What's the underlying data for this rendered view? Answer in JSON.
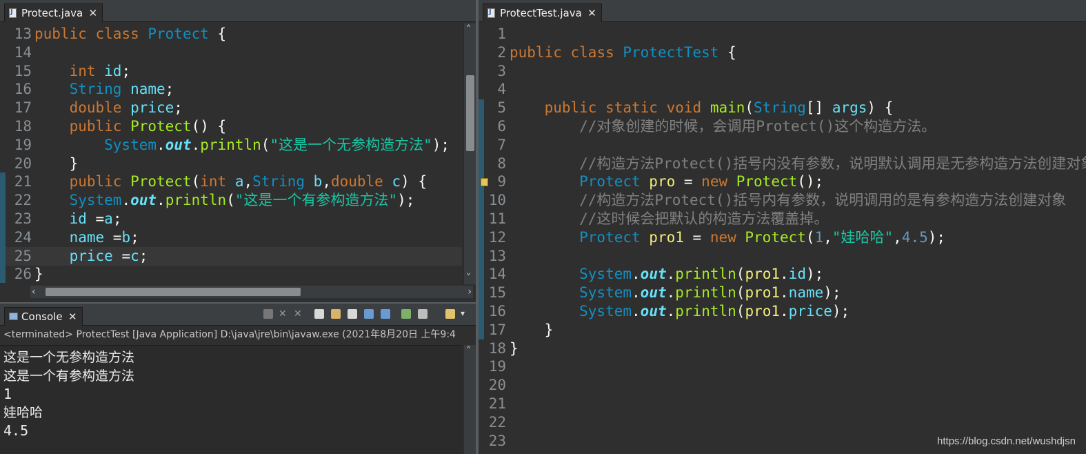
{
  "left_editor": {
    "tab_title": "Protect.java",
    "lines": [
      {
        "n": "13",
        "parts": [
          [
            "kw",
            "public "
          ],
          [
            "kw",
            "class "
          ],
          [
            "cls",
            "Protect "
          ],
          [
            "br",
            "{"
          ]
        ]
      },
      {
        "n": "14",
        "parts": []
      },
      {
        "n": "15",
        "parts": [
          [
            "kw",
            "    int "
          ],
          [
            "fld",
            "id"
          ],
          [
            "br",
            ";"
          ]
        ]
      },
      {
        "n": "16",
        "parts": [
          [
            "cls",
            "    String "
          ],
          [
            "fld",
            "name"
          ],
          [
            "br",
            ";"
          ]
        ]
      },
      {
        "n": "17",
        "parts": [
          [
            "kw",
            "    double "
          ],
          [
            "fld",
            "price"
          ],
          [
            "br",
            ";"
          ]
        ]
      },
      {
        "n": "18",
        "parts": [
          [
            "kw",
            "    public "
          ],
          [
            "mth",
            "Protect"
          ],
          [
            "br",
            "() {"
          ]
        ]
      },
      {
        "n": "19",
        "parts": [
          [
            "cls",
            "        System"
          ],
          [
            "br",
            "."
          ],
          [
            "it",
            "out"
          ],
          [
            "br",
            "."
          ],
          [
            "mth",
            "println"
          ],
          [
            "br",
            "("
          ],
          [
            "str",
            "\"这是一个无参构造方法\""
          ],
          [
            "br",
            ");"
          ]
        ]
      },
      {
        "n": "20",
        "parts": [
          [
            "br",
            "    }"
          ]
        ]
      },
      {
        "n": "21",
        "parts": [
          [
            "kw",
            "    public "
          ],
          [
            "mth",
            "Protect"
          ],
          [
            "br",
            "("
          ],
          [
            "kw",
            "int "
          ],
          [
            "fld",
            "a"
          ],
          [
            "br",
            ","
          ],
          [
            "cls",
            "String "
          ],
          [
            "fld",
            "b"
          ],
          [
            "br",
            ","
          ],
          [
            "kw",
            "double "
          ],
          [
            "fld",
            "c"
          ],
          [
            "br",
            ") {"
          ]
        ]
      },
      {
        "n": "22",
        "parts": [
          [
            "cls",
            "    System"
          ],
          [
            "br",
            "."
          ],
          [
            "it",
            "out"
          ],
          [
            "br",
            "."
          ],
          [
            "mth",
            "println"
          ],
          [
            "br",
            "("
          ],
          [
            "str",
            "\"这是一个有参构造方法\""
          ],
          [
            "br",
            ");"
          ]
        ]
      },
      {
        "n": "23",
        "parts": [
          [
            "fld",
            "    id "
          ],
          [
            "br",
            "="
          ],
          [
            "fld",
            "a"
          ],
          [
            "br",
            ";"
          ]
        ]
      },
      {
        "n": "24",
        "parts": [
          [
            "fld",
            "    name "
          ],
          [
            "br",
            "="
          ],
          [
            "fld",
            "b"
          ],
          [
            "br",
            ";"
          ]
        ]
      },
      {
        "n": "25",
        "parts": [
          [
            "fld",
            "    price "
          ],
          [
            "br",
            "="
          ],
          [
            "fld",
            "c"
          ],
          [
            "br",
            ";"
          ]
        ]
      },
      {
        "n": "26",
        "parts": [
          [
            "br",
            "}"
          ]
        ]
      }
    ]
  },
  "console": {
    "tab_title": "Console",
    "status": "<terminated> ProtectTest [Java Application] D:\\java\\jre\\bin\\javaw.exe (2021年8月20日 上午9:4",
    "output": [
      "这是一个无参构造方法",
      "这是一个有参构造方法",
      "1",
      "娃哈哈",
      "4.5"
    ]
  },
  "right_editor": {
    "tab_title": "ProtectTest.java",
    "lines": [
      {
        "n": "1",
        "parts": []
      },
      {
        "n": "2",
        "parts": [
          [
            "kw",
            "public "
          ],
          [
            "kw",
            "class "
          ],
          [
            "cls",
            "ProtectTest "
          ],
          [
            "br",
            "{"
          ]
        ]
      },
      {
        "n": "3",
        "parts": []
      },
      {
        "n": "4",
        "parts": []
      },
      {
        "n": "5",
        "parts": [
          [
            "kw",
            "    public "
          ],
          [
            "kw",
            "static "
          ],
          [
            "kw",
            "void "
          ],
          [
            "mth",
            "main"
          ],
          [
            "br",
            "("
          ],
          [
            "cls",
            "String"
          ],
          [
            "br",
            "[] "
          ],
          [
            "fld",
            "args"
          ],
          [
            "br",
            ") {"
          ]
        ]
      },
      {
        "n": "6",
        "parts": [
          [
            "cmt",
            "        //对象创建的时候，会调用Protect()这个构造方法。"
          ]
        ]
      },
      {
        "n": "7",
        "parts": []
      },
      {
        "n": "8",
        "parts": [
          [
            "cmt",
            "        //构造方法Protect()括号内没有参数，说明默认调用是无参构造方法创建对象"
          ]
        ]
      },
      {
        "n": "9",
        "parts": [
          [
            "cls",
            "        Protect "
          ],
          [
            "var",
            "pro"
          ],
          [
            "br",
            " = "
          ],
          [
            "kw",
            "new "
          ],
          [
            "mth",
            "Protect"
          ],
          [
            "br",
            "();"
          ]
        ]
      },
      {
        "n": "10",
        "parts": [
          [
            "cmt",
            "        //构造方法Protect()括号内有参数，说明调用的是有参构造方法创建对象"
          ]
        ]
      },
      {
        "n": "11",
        "parts": [
          [
            "cmt",
            "        //这时候会把默认的构造方法覆盖掉。"
          ]
        ]
      },
      {
        "n": "12",
        "parts": [
          [
            "cls",
            "        Protect "
          ],
          [
            "var",
            "pro1"
          ],
          [
            "br",
            " = "
          ],
          [
            "kw",
            "new "
          ],
          [
            "mth",
            "Protect"
          ],
          [
            "br",
            "("
          ],
          [
            "num",
            "1"
          ],
          [
            "br",
            ","
          ],
          [
            "str",
            "\"娃哈哈\""
          ],
          [
            "br",
            ","
          ],
          [
            "num",
            "4.5"
          ],
          [
            "br",
            ");"
          ]
        ]
      },
      {
        "n": "13",
        "parts": []
      },
      {
        "n": "14",
        "parts": [
          [
            "cls",
            "        System"
          ],
          [
            "br",
            "."
          ],
          [
            "it",
            "out"
          ],
          [
            "br",
            "."
          ],
          [
            "mth",
            "println"
          ],
          [
            "br",
            "("
          ],
          [
            "var",
            "pro1"
          ],
          [
            "br",
            "."
          ],
          [
            "fld",
            "id"
          ],
          [
            "br",
            ");"
          ]
        ]
      },
      {
        "n": "15",
        "parts": [
          [
            "cls",
            "        System"
          ],
          [
            "br",
            "."
          ],
          [
            "it",
            "out"
          ],
          [
            "br",
            "."
          ],
          [
            "mth",
            "println"
          ],
          [
            "br",
            "("
          ],
          [
            "var",
            "pro1"
          ],
          [
            "br",
            "."
          ],
          [
            "fld",
            "name"
          ],
          [
            "br",
            ");"
          ]
        ]
      },
      {
        "n": "16",
        "parts": [
          [
            "cls",
            "        System"
          ],
          [
            "br",
            "."
          ],
          [
            "it",
            "out"
          ],
          [
            "br",
            "."
          ],
          [
            "mth",
            "println"
          ],
          [
            "br",
            "("
          ],
          [
            "var",
            "pro1"
          ],
          [
            "br",
            "."
          ],
          [
            "fld",
            "price"
          ],
          [
            "br",
            ");"
          ]
        ]
      },
      {
        "n": "17",
        "parts": [
          [
            "br",
            "    }"
          ]
        ]
      },
      {
        "n": "18",
        "parts": [
          [
            "br",
            "}"
          ]
        ]
      },
      {
        "n": "19",
        "parts": []
      },
      {
        "n": "20",
        "parts": []
      },
      {
        "n": "21",
        "parts": []
      },
      {
        "n": "22",
        "parts": []
      },
      {
        "n": "23",
        "parts": []
      }
    ]
  },
  "watermark": "https://blog.csdn.net/wushdjsn"
}
